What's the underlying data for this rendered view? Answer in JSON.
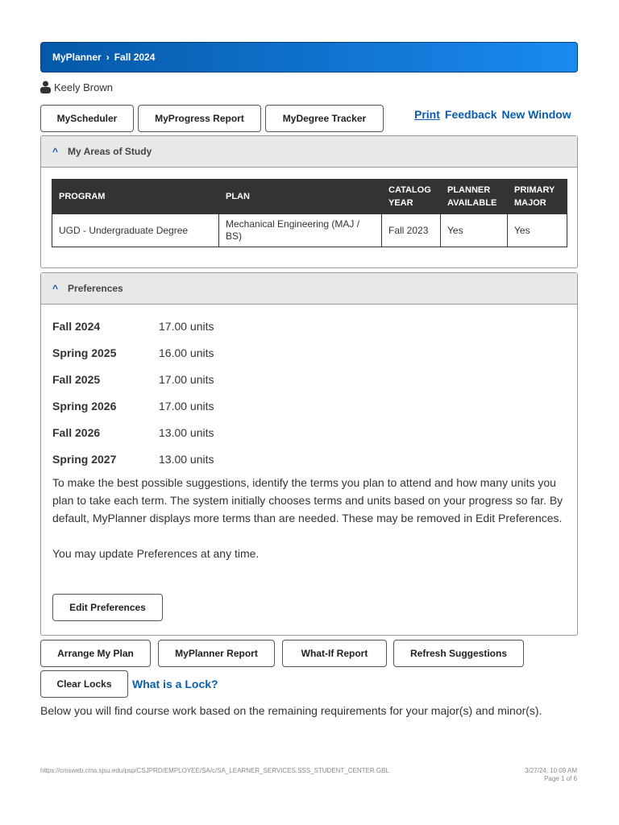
{
  "breadcrumb": [
    "MyPlanner",
    "Fall 2024"
  ],
  "user": "Keely Brown",
  "nav_buttons": [
    "MyScheduler",
    "MyProgress Report",
    "MyDegree Tracker"
  ],
  "links": [
    "Print",
    "Feedback",
    "New Window"
  ],
  "areas": {
    "title": "My Areas of Study",
    "headers": [
      "PROGRAM",
      "PLAN",
      "CATALOG YEAR",
      "PLANNER AVAILABLE",
      "PRIMARY MAJOR"
    ],
    "row": [
      "UGD - Undergraduate Degree",
      "Mechanical Engineering (MAJ / BS)",
      "Fall 2023",
      "Yes",
      "Yes"
    ]
  },
  "preferences": {
    "title": "Preferences",
    "terms": [
      {
        "term": "Fall 2024",
        "units": "17.00 units"
      },
      {
        "term": "Spring 2025",
        "units": "16.00 units"
      },
      {
        "term": "Fall 2025",
        "units": "17.00 units"
      },
      {
        "term": "Spring 2026",
        "units": "17.00 units"
      },
      {
        "term": "Fall 2026",
        "units": "13.00 units"
      },
      {
        "term": "Spring 2027",
        "units": "13.00 units"
      }
    ],
    "info": "To make the best possible suggestions, identify the terms you plan to attend and how many units you plan to take each term. The system initially chooses terms and units based on your progress so far. By default, MyPlanner displays more terms than are needed. These may be removed in Edit Preferences.",
    "update": "You may update Preferences at any time.",
    "edit_button": "Edit Preferences"
  },
  "action_buttons": [
    "Arrange My Plan",
    "MyPlanner Report",
    "What-If Report",
    "Refresh Suggestions"
  ],
  "clear_locks": "Clear Locks",
  "lock_link": "What is a Lock?",
  "below_text": "Below you will find course work based on the remaining requirements for your major(s) and minor(s).",
  "footer": {
    "url": "https://cmsweb.cms.sjsu.edu/psp/CSJPRD/EMPLOYEE/SA/c/SA_LEARNER_SERVICES.SSS_STUDENT_CENTER.GBL",
    "datetime": "3/27/24, 10:09 AM",
    "page": "Page 1 of 6"
  },
  "colors": {
    "accent": "#0b5cad",
    "banner_start": "#0558a8",
    "banner_end": "#1a8af0"
  }
}
